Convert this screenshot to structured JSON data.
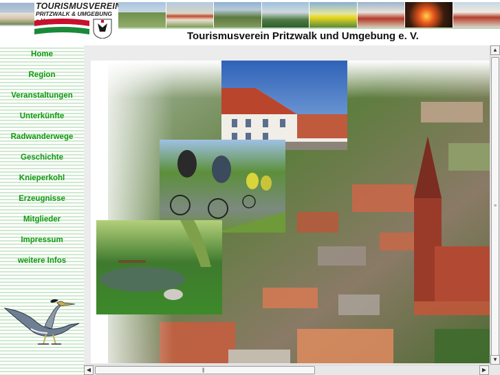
{
  "logo": {
    "title": "TOURISMUSVEREIN",
    "subtitle": "PRITZWALK & UMGEBUNG e.V.",
    "crest": "town-crest-icon"
  },
  "header": {
    "site_title": "Tourismusverein Pritzwalk und Umgebung e. V."
  },
  "nav": {
    "items": [
      {
        "label": "Home"
      },
      {
        "label": "Region"
      },
      {
        "label": "Veranstaltungen"
      },
      {
        "label": "Unterkünfte"
      },
      {
        "label": "Radwanderwege"
      },
      {
        "label": "Geschichte"
      },
      {
        "label": "Knieperkohl"
      },
      {
        "label": "Erzeugnisse"
      },
      {
        "label": "Mitglieder"
      },
      {
        "label": "Impressum"
      },
      {
        "label": "weitere Infos"
      }
    ]
  },
  "sidebar": {
    "mascot": "heron-cyclist-icon"
  },
  "colors": {
    "nav_text": "#109a10",
    "sidebar_stripe": "#cfe9cf",
    "flag_red": "#c8102e",
    "flag_green": "#1a8a3a"
  },
  "icons": {
    "scroll_up": "arrow-up-icon",
    "scroll_down": "arrow-down-icon",
    "scroll_left": "arrow-left-icon",
    "scroll_right": "arrow-right-icon"
  }
}
